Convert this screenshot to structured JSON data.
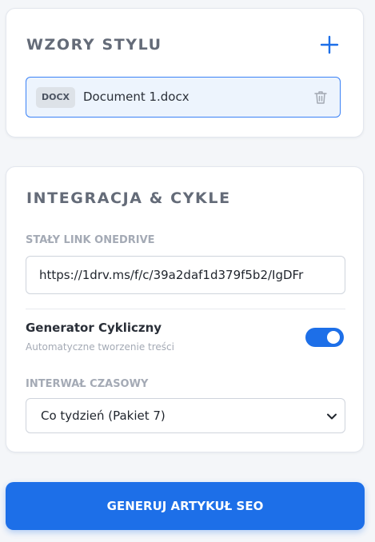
{
  "style_templates": {
    "title": "WZORY STYLU",
    "add_icon": "plus-icon",
    "file": {
      "type": "DOCX",
      "name": "Document 1.docx",
      "delete_icon": "trash-icon"
    }
  },
  "integration": {
    "title": "INTEGRACJA & CYKLE",
    "onedrive_label": "STAŁY LINK ONEDRIVE",
    "onedrive_value": "https://1drv.ms/f/c/39a2daf1d379f5b2/IgDFr",
    "generator_title": "Generator Cykliczny",
    "generator_subtitle": "Automatyczne tworzenie treści",
    "generator_enabled": true,
    "interval_label": "INTERWAŁ CZASOWY",
    "interval_value": "Co tydzień (Pakiet 7)",
    "interval_icon": "chevron-down-icon"
  },
  "actions": {
    "generate_label": "GENERUJ ARTYKUŁ SEO"
  },
  "colors": {
    "accent": "#1d6fe8",
    "page_background": "#f4f6f9",
    "file_row_background": "#edf4fd",
    "heading": "#646b78",
    "muted_label": "#a4aab5"
  }
}
